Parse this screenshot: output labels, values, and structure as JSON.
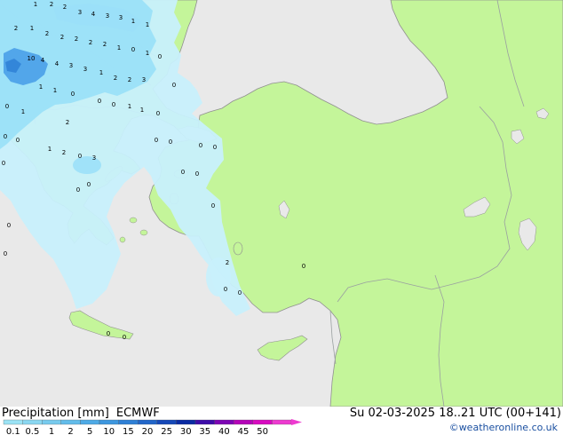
{
  "title": {
    "label": "Precipitation [mm]",
    "model": "ECMWF"
  },
  "valid_time": "Su 02-03-2025 18..21 UTC (00+141)",
  "credit": "©weatheronline.co.uk",
  "colors": {
    "sea": "#e9e9e9",
    "land": "#c4f59a",
    "border": "#9aa0a0",
    "coast": "#909090",
    "precip_light": "#c8f0fc",
    "precip_medium": "#9be0f8",
    "precip_heavy": "#4aa0e8"
  },
  "legend": {
    "ticks": [
      "0.1",
      "0.5",
      "1",
      "2",
      "5",
      "10",
      "15",
      "20",
      "25",
      "30",
      "35",
      "40",
      "45",
      "50"
    ],
    "colors": [
      "#9be3f5",
      "#8ad7f1",
      "#78cbee",
      "#62bcea",
      "#4eaae6",
      "#3d97df",
      "#2e80d6",
      "#2166c9",
      "#1548b8",
      "#0a2aa3",
      "#3d0ca8",
      "#7d05b4",
      "#b404b8",
      "#d80ac0",
      "#ee3ad0"
    ]
  },
  "precip_labels": [
    "1",
    "2",
    "2",
    "3",
    "4",
    "3",
    "3",
    "1",
    "1",
    "2",
    "1",
    "2",
    "2",
    "2",
    "2",
    "2",
    "1",
    "0",
    "1",
    "10",
    "4",
    "4",
    "3",
    "3",
    "1",
    "2",
    "2",
    "3",
    "0",
    "0",
    "1",
    "1",
    "0",
    "0",
    "0",
    "1",
    "1",
    "0",
    "0",
    "1",
    "2",
    "1",
    "2",
    "0",
    "3",
    "0",
    "0",
    "0",
    "0",
    "0",
    "0",
    "0",
    "0",
    "0",
    "2",
    "0",
    "0",
    "0",
    "0",
    "0",
    "0",
    "0",
    "0",
    "0",
    "0"
  ]
}
